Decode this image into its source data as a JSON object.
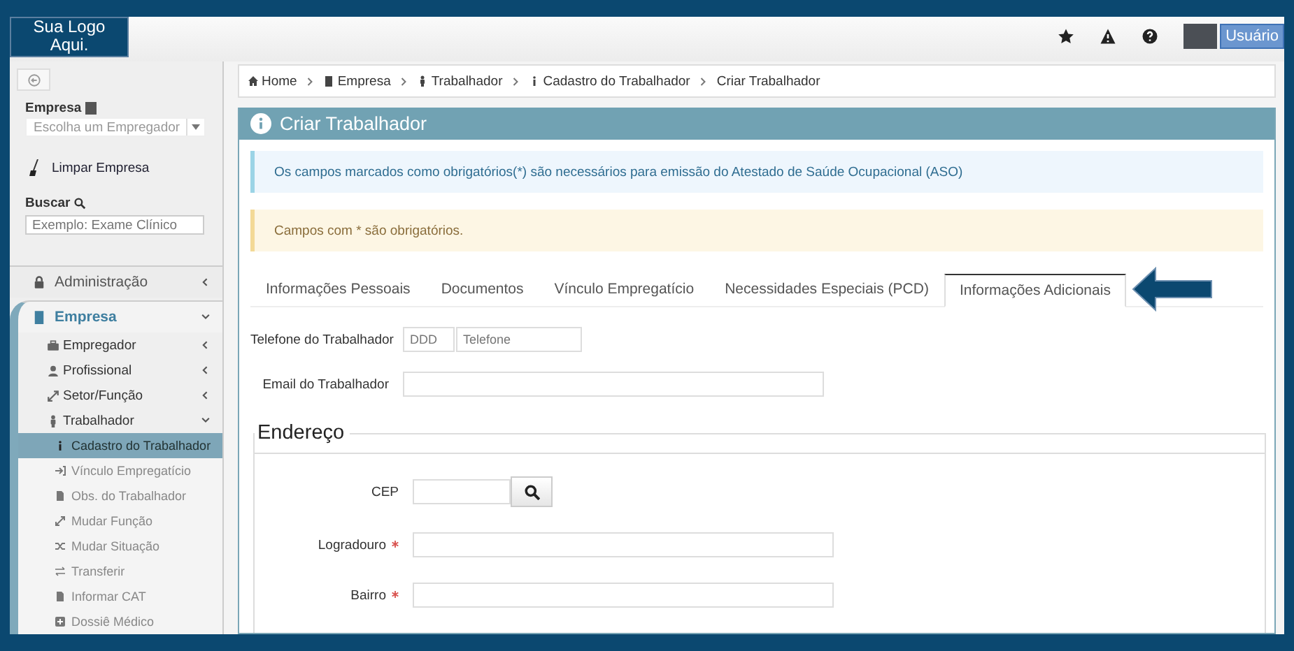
{
  "logo": {
    "text": "Sua Logo Aqui."
  },
  "topbar": {
    "user_button": "Usuário"
  },
  "sidebar": {
    "company_label": "Empresa",
    "company_select_placeholder": "Escolha um Empregador",
    "clear_link": "Limpar Empresa",
    "search_label": "Buscar",
    "search_placeholder": "Exemplo: Exame Clínico",
    "menu": [
      {
        "label": "Administração",
        "kind": "lock",
        "expanded": false
      },
      {
        "label": "Empresa",
        "kind": "building",
        "expanded": true,
        "children": [
          {
            "label": "Empregador",
            "kind": "briefcase",
            "expanded": false
          },
          {
            "label": "Profissional",
            "kind": "user",
            "expanded": false
          },
          {
            "label": "Setor/Função",
            "kind": "expand",
            "expanded": false
          },
          {
            "label": "Trabalhador",
            "kind": "person",
            "expanded": true,
            "children": [
              {
                "label": "Cadastro do Trabalhador",
                "kind": "info",
                "selected": true
              },
              {
                "label": "Vínculo Empregatício",
                "kind": "signin",
                "selected": false
              },
              {
                "label": "Obs. do Trabalhador",
                "kind": "file",
                "selected": false
              },
              {
                "label": "Mudar Função",
                "kind": "expand",
                "selected": false
              },
              {
                "label": "Mudar Situação",
                "kind": "shuffle",
                "selected": false
              },
              {
                "label": "Transferir",
                "kind": "exchange",
                "selected": false
              },
              {
                "label": "Informar CAT",
                "kind": "file",
                "selected": false
              },
              {
                "label": "Dossiê Médico",
                "kind": "plus",
                "selected": false
              }
            ]
          }
        ]
      }
    ]
  },
  "breadcrumb": [
    {
      "label": "Home",
      "kind": "home"
    },
    {
      "label": "Empresa",
      "kind": "building"
    },
    {
      "label": "Trabalhador",
      "kind": "person"
    },
    {
      "label": "Cadastro do Trabalhador",
      "kind": "info"
    },
    {
      "label": "Criar Trabalhador",
      "kind": "plain"
    }
  ],
  "panel": {
    "title": "Criar Trabalhador",
    "alerts": [
      {
        "kind": "info",
        "text": "Os campos marcados como obrigatórios(*) são necessários para emissão do Atestado de Saúde Ocupacional (ASO)"
      },
      {
        "kind": "warning",
        "text": "Campos com * são obrigatórios."
      }
    ],
    "tabs": [
      {
        "label": "Informações Pessoais",
        "selected": false
      },
      {
        "label": "Documentos",
        "selected": false
      },
      {
        "label": "Vínculo Empregatício",
        "selected": false
      },
      {
        "label": "Necessidades Especiais (PCD)",
        "selected": false
      },
      {
        "label": "Informações Adicionais",
        "selected": true
      }
    ],
    "fields": [
      {
        "label": "Telefone do Trabalhador",
        "kind": "phone",
        "placeholders": [
          "DDD",
          "Telefone"
        ],
        "required": false
      },
      {
        "label": "Email do Trabalhador",
        "kind": "text",
        "required": false
      }
    ],
    "address": {
      "legend": "Endereço",
      "fields": [
        {
          "label": "CEP",
          "kind": "search",
          "required": false
        },
        {
          "label": "Logradouro",
          "kind": "text",
          "required": true
        },
        {
          "label": "Bairro",
          "kind": "text",
          "required": true
        }
      ]
    }
  }
}
